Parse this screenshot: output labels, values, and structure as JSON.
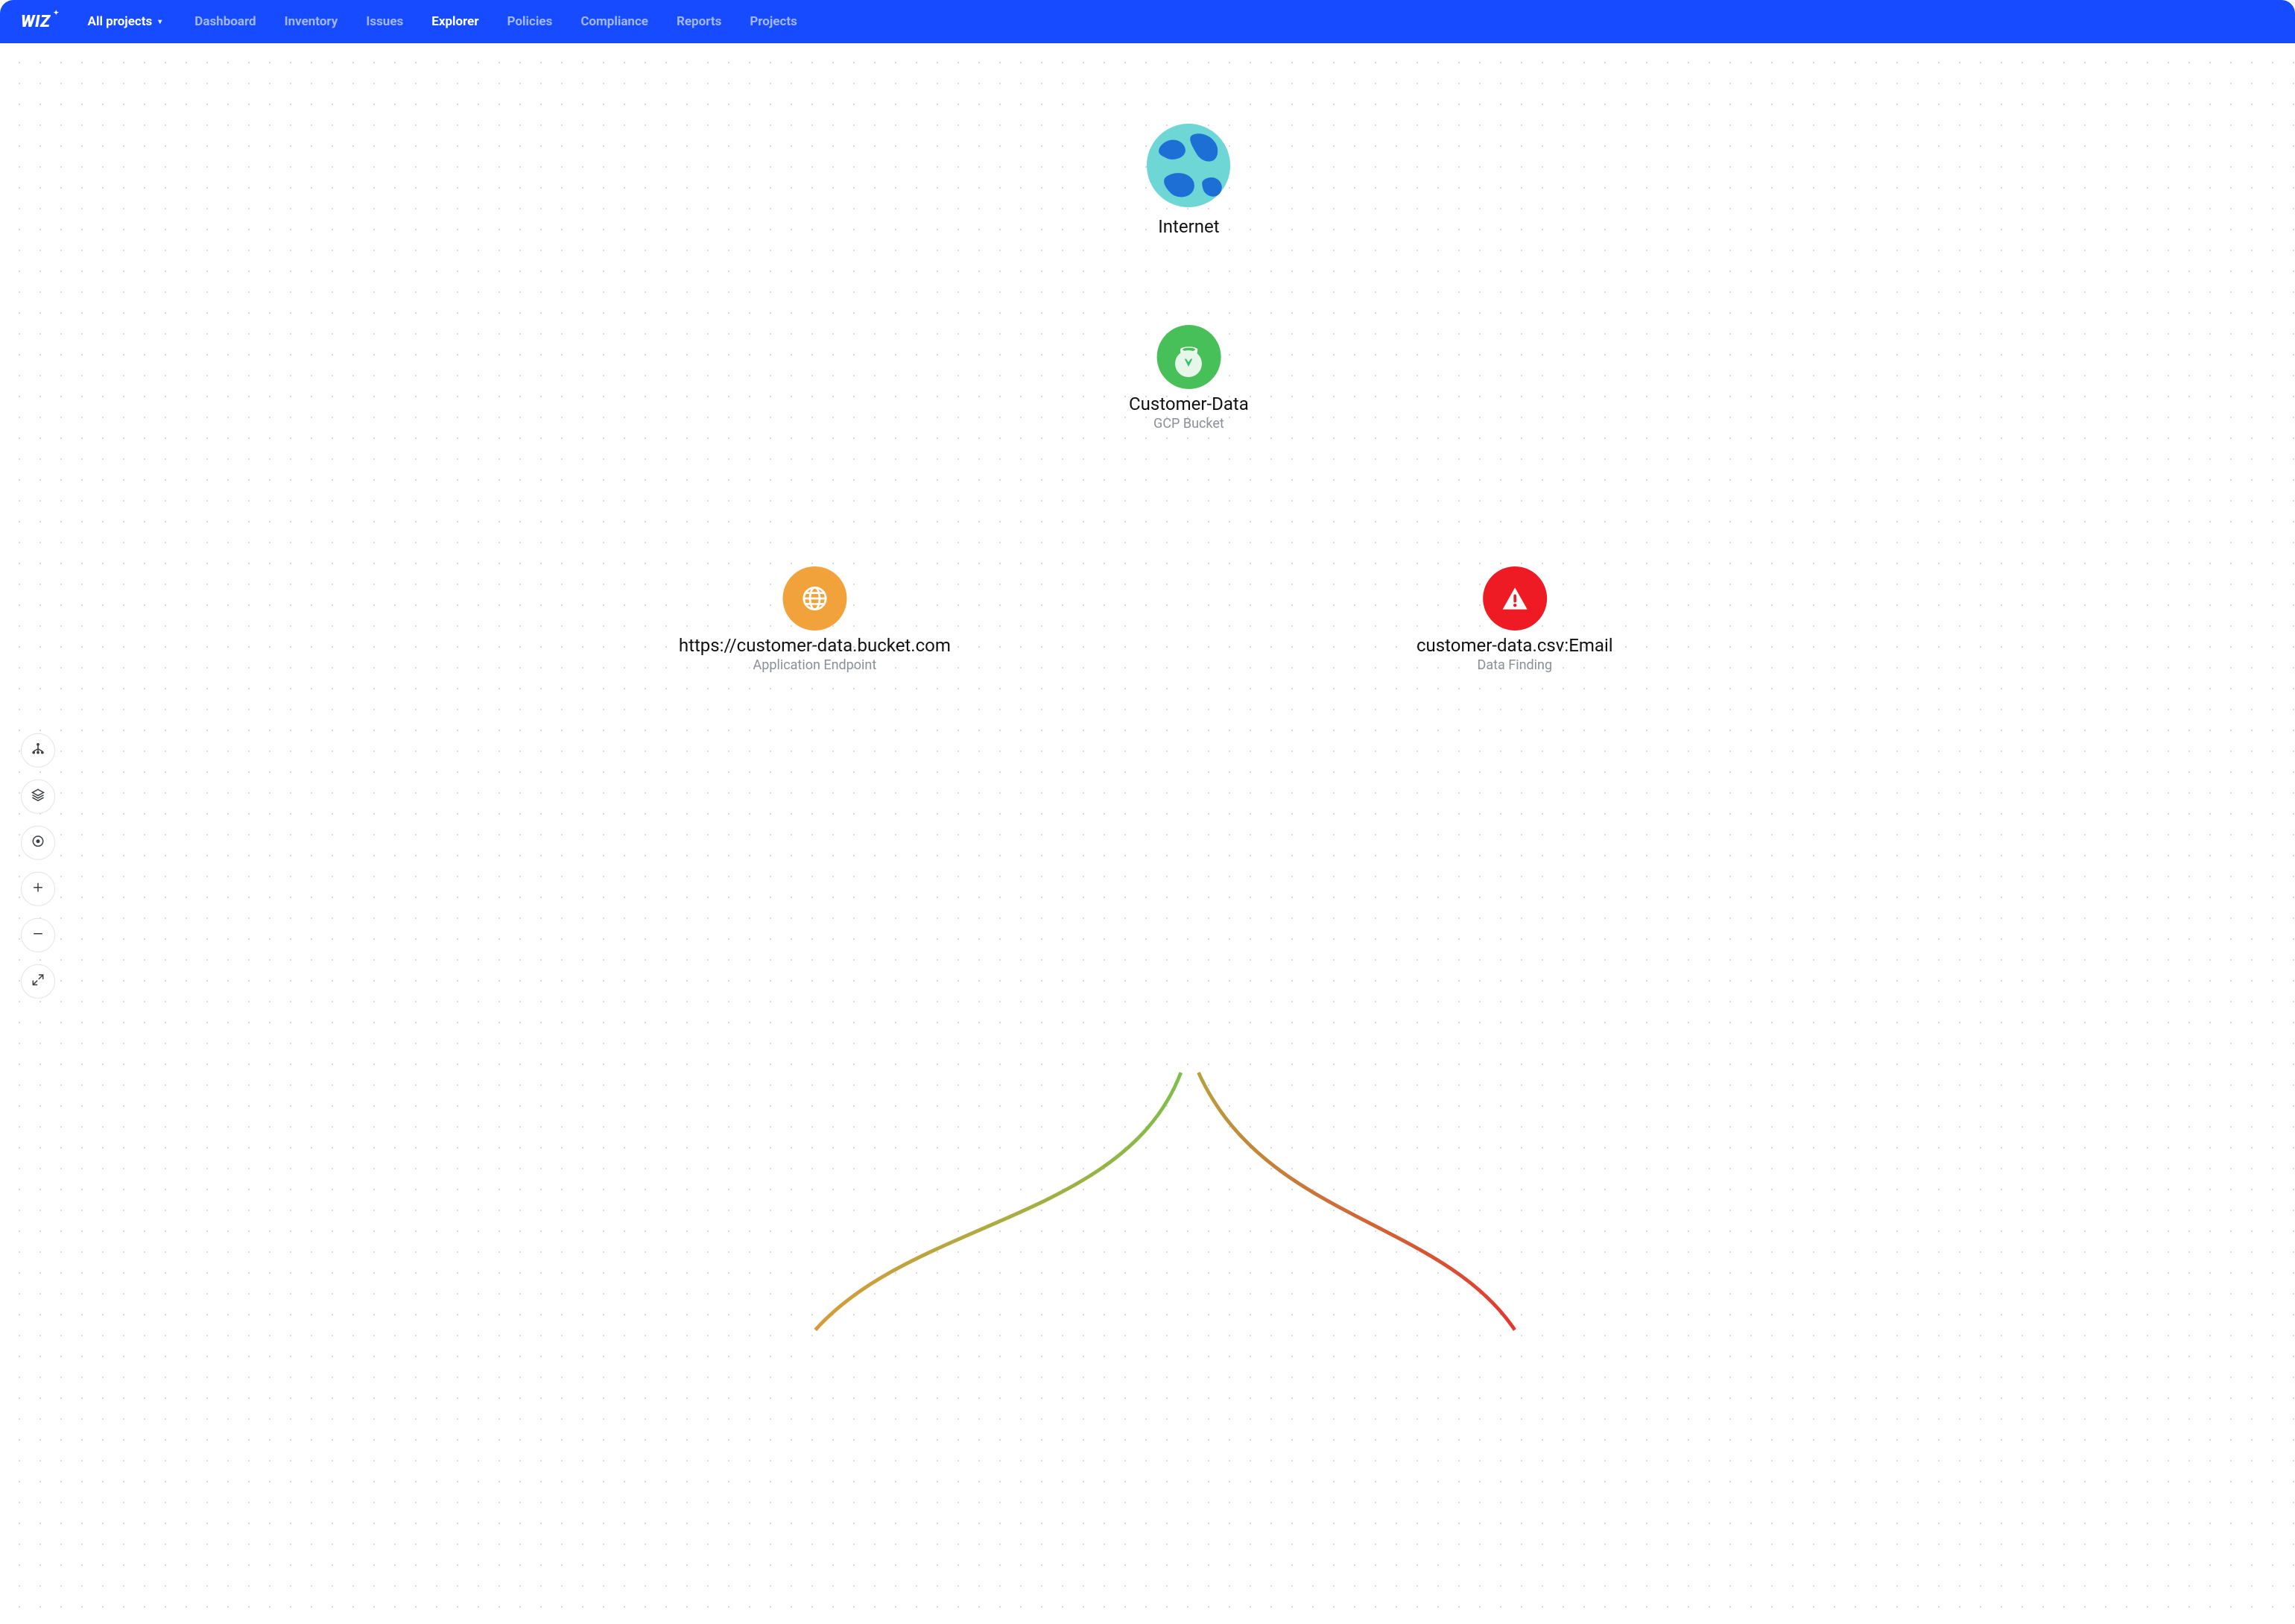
{
  "brand": "WIZ",
  "project_selector": {
    "label": "All projects"
  },
  "nav": {
    "items": [
      {
        "label": "Dashboard",
        "active": false
      },
      {
        "label": "Inventory",
        "active": false
      },
      {
        "label": "Issues",
        "active": false
      },
      {
        "label": "Explorer",
        "active": true
      },
      {
        "label": "Policies",
        "active": false
      },
      {
        "label": "Compliance",
        "active": false
      },
      {
        "label": "Reports",
        "active": false
      },
      {
        "label": "Projects",
        "active": false
      }
    ]
  },
  "tools": [
    {
      "name": "graph-view-icon"
    },
    {
      "name": "layers-icon"
    },
    {
      "name": "focus-icon"
    },
    {
      "name": "zoom-in-icon"
    },
    {
      "name": "zoom-out-icon"
    },
    {
      "name": "expand-icon"
    }
  ],
  "graph": {
    "nodes": {
      "internet": {
        "title": "Internet",
        "subtitle": "",
        "icon": "globe-icon"
      },
      "bucket": {
        "title": "Customer-Data",
        "subtitle": "GCP Bucket",
        "icon": "bucket-icon",
        "color": "#47c059"
      },
      "endpoint": {
        "title": "https://customer-data.bucket.com",
        "subtitle": "Application Endpoint",
        "icon": "web-icon",
        "color": "#f2a23a"
      },
      "finding": {
        "title": "customer-data.csv:Email",
        "subtitle": "Data Finding",
        "icon": "alert-icon",
        "color": "#ee1b24"
      }
    },
    "edge_badge": {
      "icon": "diamond-icon",
      "color": "#33c466"
    }
  }
}
